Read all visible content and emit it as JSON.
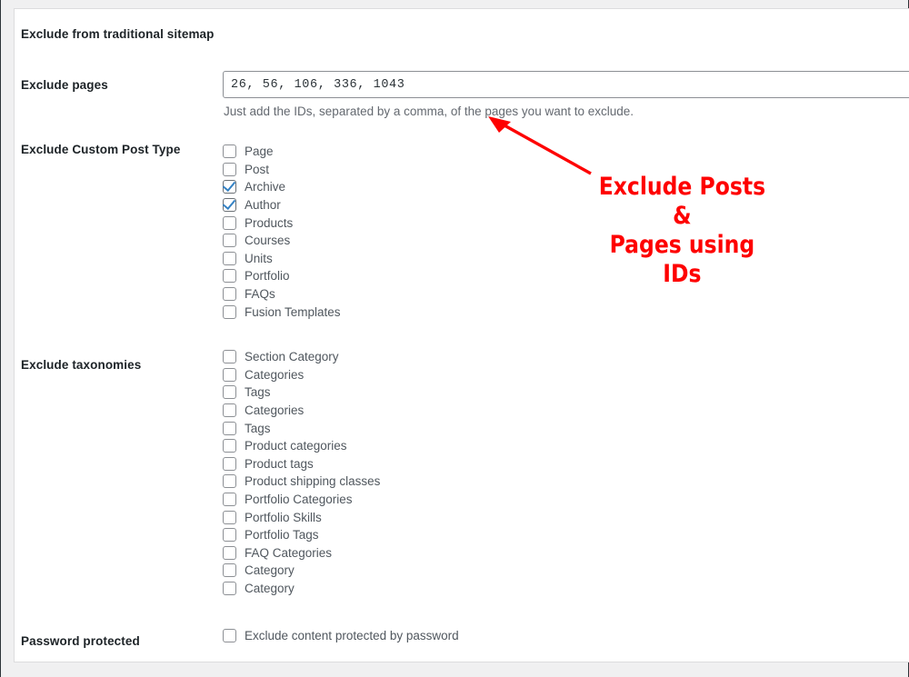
{
  "panel": {
    "section_title": "Exclude from traditional sitemap"
  },
  "fields": {
    "exclude_pages": {
      "label": "Exclude pages",
      "value": "26, 56, 106, 336, 1043",
      "placeholder": "",
      "description": "Just add the IDs, separated by a comma, of the pages you want to exclude."
    },
    "exclude_custom_post_type": {
      "label": "Exclude Custom Post Type",
      "options": [
        {
          "label": "Page",
          "checked": false
        },
        {
          "label": "Post",
          "checked": false
        },
        {
          "label": "Archive",
          "checked": true
        },
        {
          "label": "Author",
          "checked": true
        },
        {
          "label": "Products",
          "checked": false
        },
        {
          "label": "Courses",
          "checked": false
        },
        {
          "label": "Units",
          "checked": false
        },
        {
          "label": "Portfolio",
          "checked": false
        },
        {
          "label": "FAQs",
          "checked": false
        },
        {
          "label": "Fusion Templates",
          "checked": false
        }
      ]
    },
    "exclude_taxonomies": {
      "label": "Exclude taxonomies",
      "options": [
        {
          "label": "Section Category",
          "checked": false
        },
        {
          "label": "Categories",
          "checked": false
        },
        {
          "label": "Tags",
          "checked": false
        },
        {
          "label": "Categories",
          "checked": false
        },
        {
          "label": "Tags",
          "checked": false
        },
        {
          "label": "Product categories",
          "checked": false
        },
        {
          "label": "Product tags",
          "checked": false
        },
        {
          "label": "Product shipping classes",
          "checked": false
        },
        {
          "label": "Portfolio Categories",
          "checked": false
        },
        {
          "label": "Portfolio Skills",
          "checked": false
        },
        {
          "label": "Portfolio Tags",
          "checked": false
        },
        {
          "label": "FAQ Categories",
          "checked": false
        },
        {
          "label": "Category",
          "checked": false
        },
        {
          "label": "Category",
          "checked": false
        }
      ]
    },
    "password_protected": {
      "label": "Password protected",
      "options": [
        {
          "label": "Exclude content protected by password",
          "checked": false
        }
      ]
    }
  },
  "annotation": {
    "text": "Exclude Posts &\nPages using IDs",
    "color": "#fe0000"
  },
  "colors": {
    "label_text": "#1d2327",
    "option_text": "#50575e",
    "description_text": "#646970",
    "checkbox_border": "#8c8f94",
    "check_accent": "#3582c4",
    "panel_border": "#dcdcde",
    "page_background": "#f0f0f1",
    "annotation_red": "#fe0000"
  }
}
